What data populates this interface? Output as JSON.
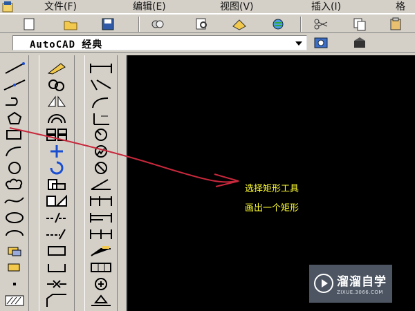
{
  "menu": {
    "items": [
      {
        "label": "文件(F)"
      },
      {
        "label": "编辑(E)"
      },
      {
        "label": "视图(V)"
      },
      {
        "label": "插入(I)"
      },
      {
        "label": "格"
      }
    ]
  },
  "workspace": {
    "selected": "AutoCAD 经典"
  },
  "annotation": {
    "line1": "选择矩形工具",
    "line2": "画出一个矩形"
  },
  "watermark": {
    "brand": "溜溜自学",
    "url": "ZIXUE.3066.COM"
  },
  "colors": {
    "canvas": "#000000",
    "annotation_text": "#ffff33",
    "arrow": "#c8283c",
    "chrome": "#d4d0c8"
  }
}
